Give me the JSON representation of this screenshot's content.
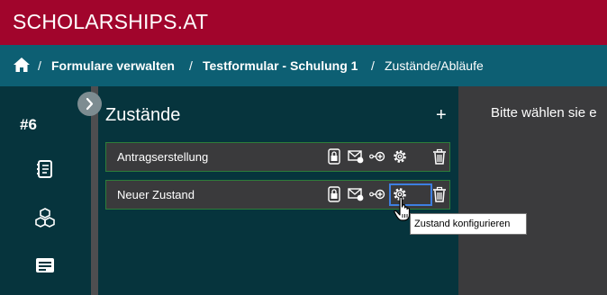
{
  "app": {
    "brand": "SCHOLARSHIPS.AT"
  },
  "breadcrumb": {
    "home_icon": "home-icon",
    "separator": "/",
    "items": [
      "Formulare verwalten",
      "Testformular - Schulung 1",
      "Zustände/Abläufe"
    ]
  },
  "sidebar": {
    "project_id": "#6",
    "icons": [
      "form-icon",
      "cubes-icon",
      "message-icon"
    ],
    "toggle_icon": "chevron-right-icon"
  },
  "states_panel": {
    "title": "Zustände",
    "add_label": "+",
    "states": [
      {
        "label": "Antragserstellung"
      },
      {
        "label": "Neuer Zustand"
      }
    ],
    "action_icons": [
      "lock-icon",
      "mail-icon",
      "transition-icon",
      "gear-icon",
      "trash-icon"
    ]
  },
  "main": {
    "hint": "Bitte wählen sie e"
  },
  "tooltip": {
    "text": "Zustand konfigurieren"
  },
  "colors": {
    "topbar": "#a1052c",
    "breadcrumb_bar": "#0d5f73",
    "panel": "#06343d",
    "row_border": "#2d7d3a",
    "focus": "#3d7fe0"
  }
}
